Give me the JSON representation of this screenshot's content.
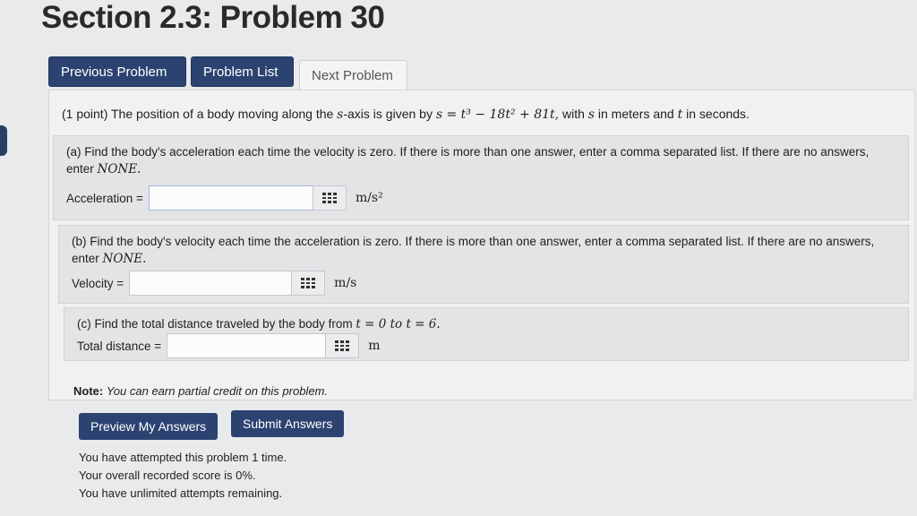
{
  "page": {
    "title": "Section 2.3: Problem 30"
  },
  "nav": {
    "previous": "Previous Problem",
    "list": "Problem List",
    "next": "Next Problem"
  },
  "problem": {
    "points": "(1 point)",
    "intro_text": "The position of a body moving along the",
    "axis_var": "s",
    "axis_suffix": "-axis is given by",
    "equation": "s = t³ − 18t² + 81t,",
    "with": "with",
    "s_var": "s",
    "units_text": "in meters and",
    "t_var": "t",
    "seconds": "in seconds."
  },
  "parts": [
    {
      "question": "(a) Find the body's acceleration each time the velocity is zero. If there is more than one answer, enter a comma separated list. If there are no answers, enter",
      "none_word": "NONE.",
      "label": "Acceleration =",
      "value": "",
      "unit": "m/s²"
    },
    {
      "question": "(b) Find the body's velocity each time the acceleration is zero. If there is more than one answer, enter a comma separated list. If there are no answers, enter",
      "none_word": "NONE.",
      "label": "Velocity =",
      "value": "",
      "unit": "m/s"
    },
    {
      "question": "(c) Find the total distance traveled by the body from",
      "range": "t = 0 to t = 6.",
      "label": "Total distance =",
      "value": "",
      "unit": "m"
    }
  ],
  "note": {
    "label": "Note:",
    "text": "You can earn partial credit on this problem."
  },
  "actions": {
    "preview": "Preview My Answers",
    "submit": "Submit Answers"
  },
  "status": [
    "You have attempted this problem 1 time.",
    "Your overall recorded score is 0%.",
    "You have unlimited attempts remaining."
  ],
  "colors": {
    "primary": "#2c4371",
    "background": "#e9eaec"
  }
}
